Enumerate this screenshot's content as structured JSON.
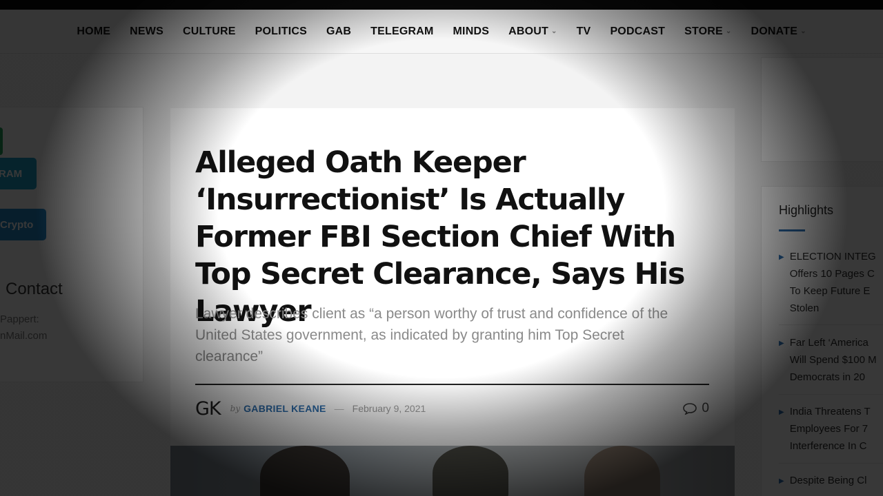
{
  "nav": {
    "items": [
      {
        "label": "HOME",
        "has_dropdown": false
      },
      {
        "label": "NEWS",
        "has_dropdown": false
      },
      {
        "label": "CULTURE",
        "has_dropdown": false
      },
      {
        "label": "POLITICS",
        "has_dropdown": false
      },
      {
        "label": "GAB",
        "has_dropdown": false
      },
      {
        "label": "TELEGRAM",
        "has_dropdown": false
      },
      {
        "label": "MINDS",
        "has_dropdown": false
      },
      {
        "label": "ABOUT",
        "has_dropdown": true
      },
      {
        "label": "TV",
        "has_dropdown": false
      },
      {
        "label": "PODCAST",
        "has_dropdown": false
      },
      {
        "label": "STORE",
        "has_dropdown": true
      },
      {
        "label": "DONATE",
        "has_dropdown": true
      }
    ]
  },
  "left_sidebar": {
    "telegram_button": "RAM",
    "crypto_button": "Crypto",
    "contact_heading": "Contact",
    "contact_line1": "Pappert:",
    "contact_line2": "nMail.com"
  },
  "article": {
    "headline": "Alleged Oath Keeper ‘Insurrectionist’ Is Actually Former FBI Section Chief With Top Secret Clearance, Says His Lawyer",
    "subheadline": "Lawyer describes client as “a person worthy of trust and confidence of the United States government, as indicated by granting him Top Secret clearance”",
    "author_initials": "GK",
    "by_label": "by",
    "author": "GABRIEL KEANE",
    "dash": "—",
    "date": "February 9, 2021",
    "comment_count": "0"
  },
  "highlights": {
    "title": "Highlights",
    "items": [
      {
        "lines": [
          "ELECTION INTEG",
          "Offers 10 Pages C",
          "To Keep Future E",
          "Stolen"
        ]
      },
      {
        "lines": [
          "Far Left ‘America",
          "Will Spend $100 M",
          "Democrats in 20"
        ]
      },
      {
        "lines": [
          "India Threatens T",
          "Employees For 7",
          "Interference In C"
        ]
      },
      {
        "lines": [
          "Despite Being Cl"
        ]
      }
    ]
  },
  "colors": {
    "accent_blue": "#2d6fb0",
    "telegram_button": "#1ca0c9",
    "green_button": "#22a35a",
    "topline": "#0b0b0b"
  }
}
